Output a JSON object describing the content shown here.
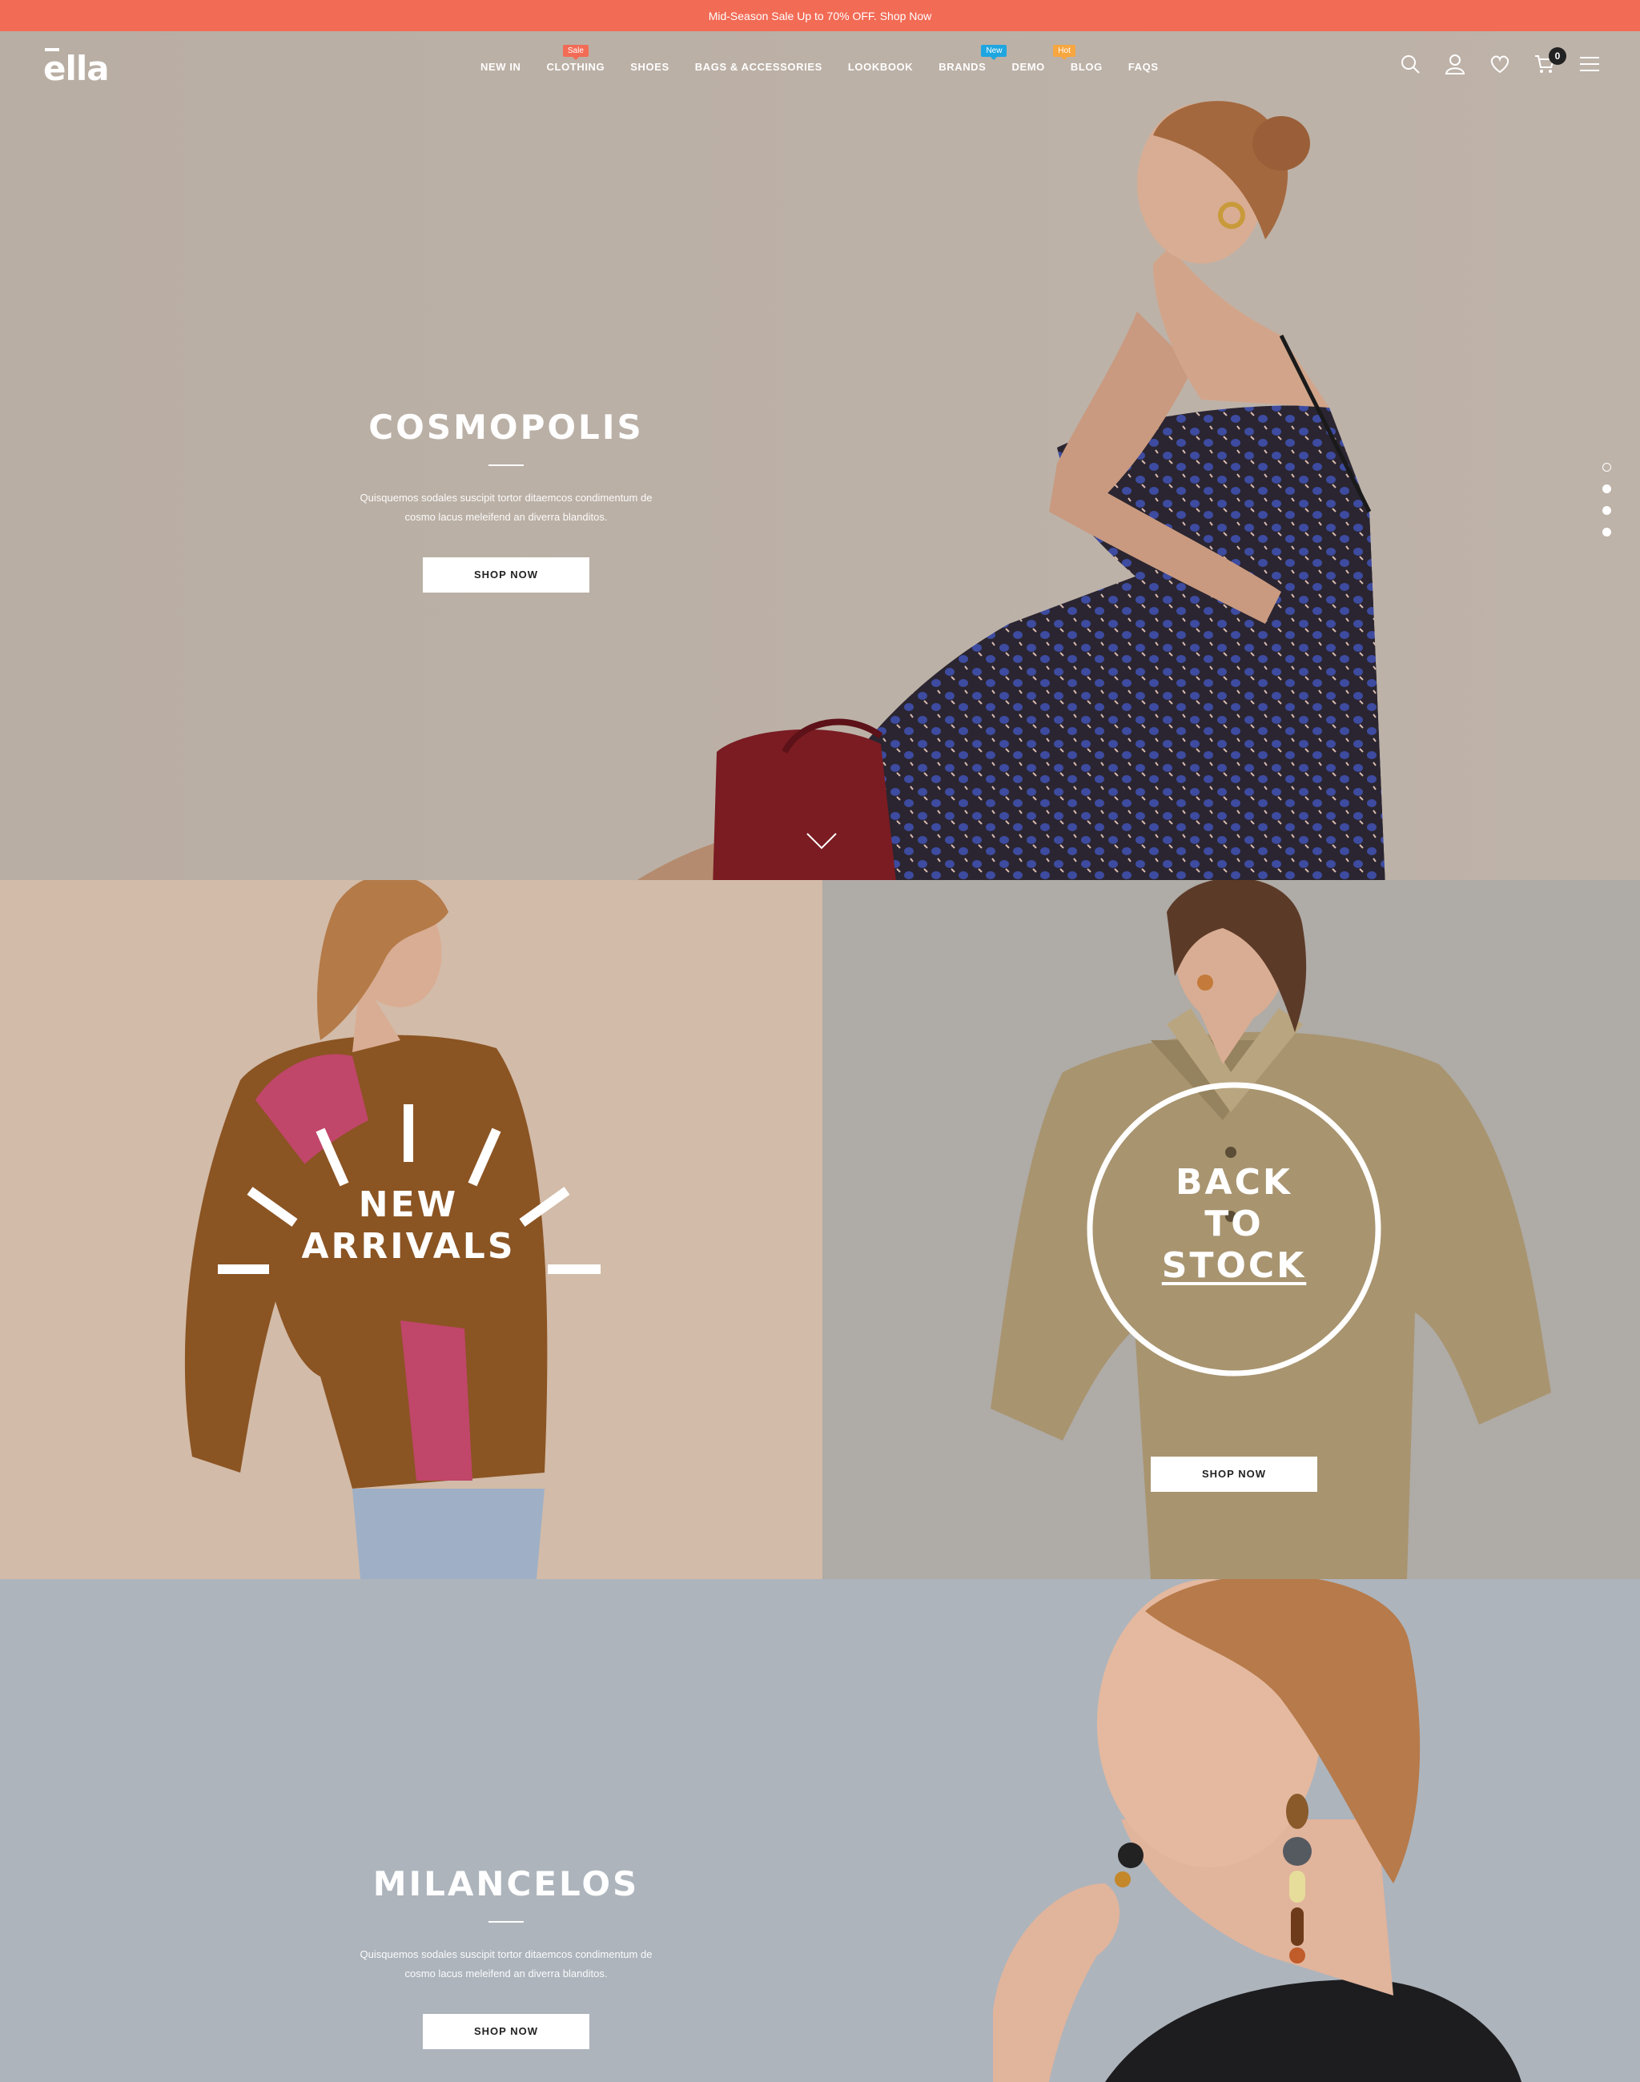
{
  "announcement": "Mid-Season Sale Up to 70% OFF. Shop Now",
  "header": {
    "logo": "ella",
    "nav": [
      {
        "label": "NEW IN",
        "badge": ""
      },
      {
        "label": "CLOTHING",
        "badge": "Sale"
      },
      {
        "label": "SHOES",
        "badge": ""
      },
      {
        "label": "BAGS & ACCESSORIES",
        "badge": ""
      },
      {
        "label": "LOOKBOOK",
        "badge": ""
      },
      {
        "label": "BRANDS",
        "badge": "New"
      },
      {
        "label": "DEMO",
        "badge": "Hot"
      },
      {
        "label": "BLOG",
        "badge": ""
      },
      {
        "label": "FAQS",
        "badge": ""
      }
    ],
    "cart_count": "0",
    "icons": [
      "search-icon",
      "account-icon",
      "wishlist-heart-icon",
      "cart-icon",
      "menu-icon"
    ]
  },
  "hero1": {
    "title": "COSMOPOLIS",
    "desc_line1": "Quisquemos sodales suscipit tortor ditaemcos condimentum de",
    "desc_line2": "cosmo lacus meleifend an diverra blanditos.",
    "button": "SHOP NOW"
  },
  "slider": {
    "dot_count": 4,
    "active_index": 0
  },
  "banner_left": {
    "line1": "NEW",
    "line2": "ARRIVALS"
  },
  "banner_right": {
    "line1": "BACK",
    "line2": "TO",
    "line3": "STOCK",
    "button": "SHOP NOW"
  },
  "hero3": {
    "title": "MILANCELOS",
    "desc_line1": "Quisquemos sodales suscipit tortor ditaemcos condimentum de",
    "desc_line2": "cosmo lacus meleifend an diverra blanditos.",
    "button": "SHOP NOW"
  },
  "colors": {
    "announcement_bg": "#f26b55",
    "badge_sale": "#f26b55",
    "badge_new": "#1fa6e0",
    "badge_hot": "#f7a640",
    "hero1_bg": "#bcb1a7",
    "banner_left_bg": "#d2bba8",
    "banner_right_bg": "#afaba6",
    "hero3_bg": "#adb4bc"
  }
}
